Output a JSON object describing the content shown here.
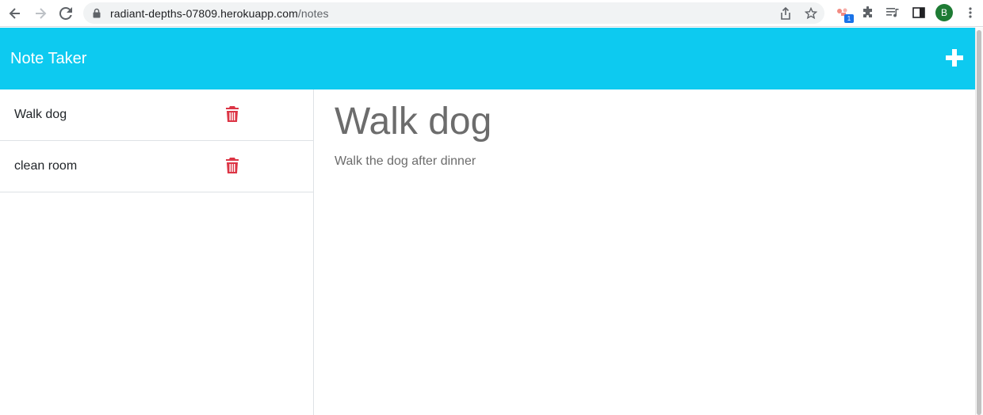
{
  "browser": {
    "url_host": "radiant-depths-07809.herokuapp.com",
    "url_path": "/notes",
    "extension_badge": "1",
    "profile_initial": "B"
  },
  "navbar": {
    "brand": "Note Taker",
    "background_color": "#0dcaf0",
    "add_icon": "plus-icon"
  },
  "sidebar": {
    "items": [
      {
        "title": "Walk dog",
        "delete_icon": "trash-icon"
      },
      {
        "title": "clean room",
        "delete_icon": "trash-icon"
      }
    ],
    "delete_color": "#dc3545"
  },
  "main": {
    "note_title": "Walk dog",
    "note_text": "Walk the dog after dinner"
  }
}
